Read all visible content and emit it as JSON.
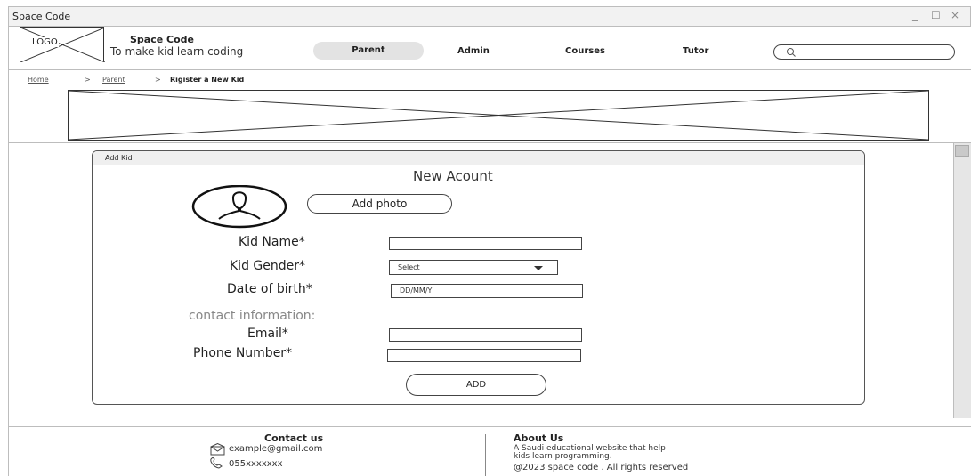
{
  "window": {
    "title": "Space Code",
    "minimize": "_",
    "maximize": "☐",
    "close": "×"
  },
  "header": {
    "logo_text": "LOGO",
    "brand_name": "Space Code",
    "tagline": "To make kid learn coding",
    "nav": [
      "Parent",
      "Admin",
      "Courses",
      "Tutor"
    ],
    "active_nav": "Parent",
    "search_placeholder": ""
  },
  "breadcrumb": {
    "items": [
      "Home",
      "Parent",
      "Rigister a New Kid"
    ],
    "separator": ">"
  },
  "form": {
    "panel_title": "Add Kid",
    "heading": "New Acount",
    "add_photo": "Add photo",
    "fields": {
      "kid_name": {
        "label": "Kid Name*",
        "value": ""
      },
      "kid_gender": {
        "label": "Kid Gender*",
        "value": "Select"
      },
      "date_of_birth": {
        "label": "Date of birth*",
        "placeholder": "DD/MM/Y"
      },
      "email": {
        "label": "Email*",
        "value": ""
      },
      "phone": {
        "label": "Phone Number*",
        "value": ""
      }
    },
    "section_contact": "contact information:",
    "submit": "ADD"
  },
  "footer": {
    "contact_title": "Contact us",
    "email": "example@gmail.com",
    "phone": "055xxxxxxx",
    "about_title": "About Us",
    "about_text": [
      "A Saudi educational website that help",
      "kids learn programming."
    ],
    "copyright": "@2023 space code . All rights reserved"
  },
  "icons": {
    "logo_placeholder": "x-box-icon",
    "search": "search-icon",
    "avatar": "user-avatar-icon",
    "dropdown": "caret-down-icon",
    "email": "envelope-icon",
    "phone": "phone-icon"
  },
  "colors": {
    "active_tab_bg": "#e3e3e3",
    "contact_label": "#888888"
  }
}
